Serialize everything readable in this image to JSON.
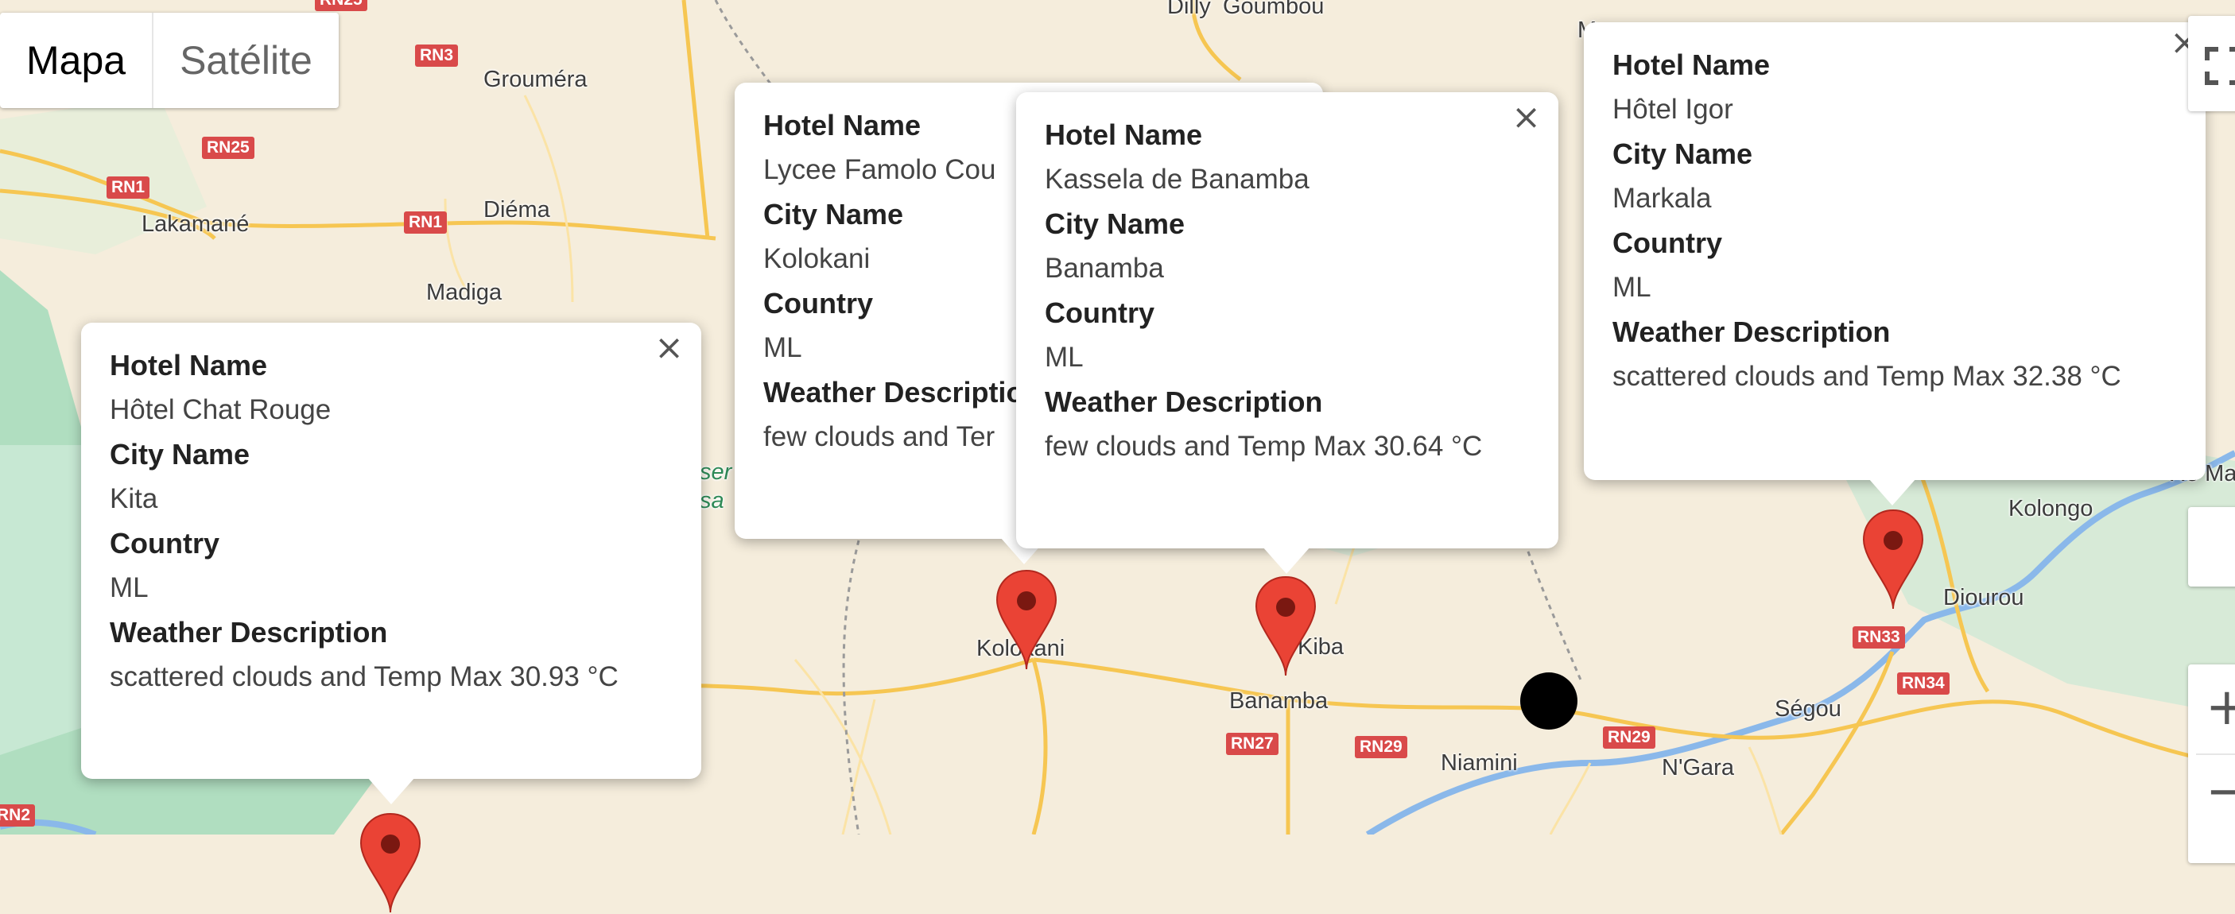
{
  "map_type": {
    "map_label": "Mapa",
    "satellite_label": "Satélite"
  },
  "places": [
    "Dilly",
    "Goumbou",
    "Grouméra",
    "Lakamané",
    "Diéma",
    "Madiga",
    "Kolokani",
    "Kiba",
    "Banamba",
    "Niamini",
    "N'Gara",
    "Ségou",
    "Diourou",
    "Kolongo",
    "Markala"
  ],
  "roads": [
    "RN25",
    "RN3",
    "RN25",
    "RN1",
    "RN1",
    "RN27",
    "RN29",
    "RN29",
    "RN33",
    "RN34",
    "RN2"
  ],
  "partial_labels": {
    "green_area": "ser sa",
    "edge_right": "Re Mass",
    "edge_top": "M"
  },
  "infowindows": [
    {
      "fields": [
        {
          "key": "Hotel Name",
          "value": "Hôtel Chat Rouge"
        },
        {
          "key": "City Name",
          "value": "Kita"
        },
        {
          "key": "Country",
          "value": "ML"
        },
        {
          "key": "Weather Description",
          "value": "scattered clouds and Temp Max 30.93 °C"
        }
      ],
      "close": "×"
    },
    {
      "fields": [
        {
          "key": "Hotel Name",
          "value": "Lycee Famolo Cou"
        },
        {
          "key": "City Name",
          "value": "Kolokani"
        },
        {
          "key": "Country",
          "value": "ML"
        },
        {
          "key": "Weather Descriptio",
          "value": "few clouds and Ter"
        }
      ],
      "close": ""
    },
    {
      "fields": [
        {
          "key": "Hotel Name",
          "value": "Kassela de Banamba"
        },
        {
          "key": "City Name",
          "value": "Banamba"
        },
        {
          "key": "Country",
          "value": "ML"
        },
        {
          "key": "Weather Description",
          "value": "few clouds and Temp Max 30.64 °C"
        }
      ],
      "close": "×"
    },
    {
      "fields": [
        {
          "key": "Hotel Name",
          "value": "Hôtel Igor"
        },
        {
          "key": "City Name",
          "value": "Markala"
        },
        {
          "key": "Country",
          "value": "ML"
        },
        {
          "key": "Weather Description",
          "value": "scattered clouds and Temp Max 32.38 °C"
        }
      ],
      "close": "×"
    }
  ],
  "controls": {
    "zoom_in": "+",
    "zoom_out": "−",
    "fullscreen": "fullscreen-icon"
  },
  "colors": {
    "land": "#f5eddc",
    "green": "#9fd8b4",
    "road_major": "#f6c652",
    "marker": "#ea4335",
    "water": "#6aa7e6"
  }
}
